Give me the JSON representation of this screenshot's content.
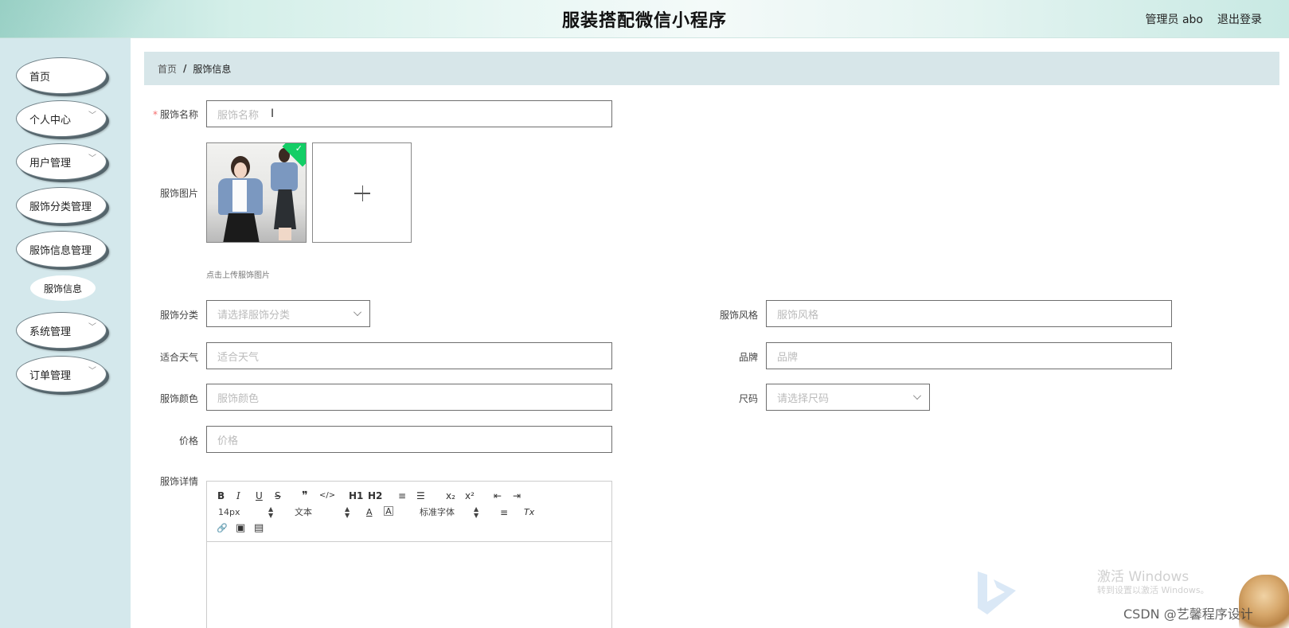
{
  "header": {
    "title": "服装搭配微信小程序",
    "user": "管理员 abo",
    "logout": "退出登录"
  },
  "sidebar": {
    "items": [
      {
        "label": "首页"
      },
      {
        "label": "个人中心"
      },
      {
        "label": "用户管理"
      },
      {
        "label": "服饰分类管理"
      },
      {
        "label": "服饰信息管理"
      },
      {
        "label": "服饰信息"
      },
      {
        "label": "系统管理"
      },
      {
        "label": "订单管理"
      }
    ]
  },
  "breadcrumb": {
    "home": "首页",
    "separator": "/",
    "current": "服饰信息"
  },
  "form": {
    "name": {
      "label": "服饰名称",
      "required": "*",
      "placeholder": "服饰名称"
    },
    "image": {
      "label": "服饰图片",
      "hint": "点击上传服饰图片"
    },
    "category": {
      "label": "服饰分类",
      "placeholder": "请选择服饰分类"
    },
    "style": {
      "label": "服饰风格",
      "placeholder": "服饰风格"
    },
    "weather": {
      "label": "适合天气",
      "placeholder": "适合天气"
    },
    "brand": {
      "label": "品牌",
      "placeholder": "品牌"
    },
    "color": {
      "label": "服饰颜色",
      "placeholder": "服饰颜色"
    },
    "size": {
      "label": "尺码",
      "placeholder": "请选择尺码"
    },
    "price": {
      "label": "价格",
      "placeholder": "价格"
    },
    "detail": {
      "label": "服饰详情"
    }
  },
  "editor": {
    "font_size": "14px",
    "text_type": "文本",
    "font_family": "标准字体",
    "buttons": {
      "bold": "B",
      "italic": "I",
      "underline": "U",
      "strike": "S",
      "quote": "❞",
      "code": "</>",
      "h1": "H1",
      "h2": "H2",
      "ol": "≡",
      "ul": "☰",
      "sub": "x₂",
      "sup": "x²",
      "outdent": "⇤",
      "indent": "⇥",
      "color": "A",
      "bg": "A",
      "align": "≡",
      "clean": "Tx",
      "link": "🔗",
      "image": "▣",
      "video": "▤"
    }
  },
  "watermark": {
    "windows_title": "激活 Windows",
    "windows_sub": "转到设置以激活 Windows。",
    "csdn": "CSDN @艺馨程序设计"
  },
  "colors": {
    "sidebar_bg": "#d4e8ec",
    "breadcrumb_bg": "#d7e6e9",
    "required": "#f56c6c",
    "upload_success": "#13ce66"
  }
}
